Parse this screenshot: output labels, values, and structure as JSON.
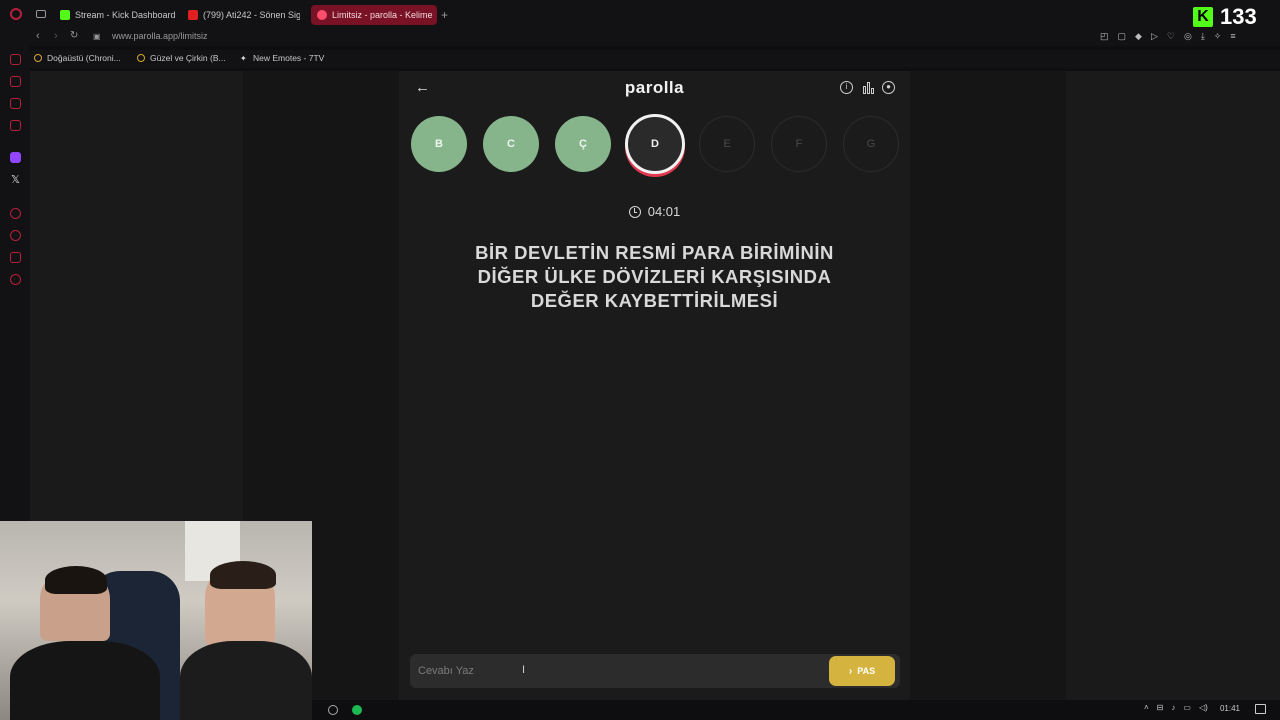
{
  "browser": {
    "tabs": [
      {
        "label": "Stream - Kick Dashboard",
        "favicon_color": "#53fc18"
      },
      {
        "label": "(799) Ati242 - Sönen Siga",
        "favicon_color": "#e02020"
      },
      {
        "label": "Limitsiz - parolla - Kelime",
        "favicon_color": "#ff4d6d",
        "active": true
      }
    ],
    "url": "www.parolla.app/limitsiz",
    "bookmarks": [
      "Doğaüstü (Chroni...",
      "Güzel ve Çirkin (B...",
      "New Emotes - 7TV"
    ]
  },
  "overlay": {
    "kick_count": "133"
  },
  "app": {
    "logo": "parolla",
    "letters": [
      {
        "letter": "B",
        "state": "done"
      },
      {
        "letter": "C",
        "state": "done"
      },
      {
        "letter": "Ç",
        "state": "done"
      },
      {
        "letter": "D",
        "state": "current"
      },
      {
        "letter": "E",
        "state": "future"
      },
      {
        "letter": "F",
        "state": "future"
      },
      {
        "letter": "G",
        "state": "future"
      }
    ],
    "timer": "04:01",
    "question_lines": [
      "BİR DEVLETİN RESMİ PARA BİRİMİNİN",
      "DİĞER ÜLKE DÖVİZLERİ KARŞISINDA",
      "DEĞER KAYBETTİRİLMESİ"
    ],
    "answer_placeholder": "Cevabı Yaz",
    "pass_label": "PAS"
  },
  "taskbar": {
    "time": "01:41"
  },
  "colors": {
    "accent": "#b5213c",
    "correct": "#86b58c",
    "pass": "#d4b43e"
  }
}
